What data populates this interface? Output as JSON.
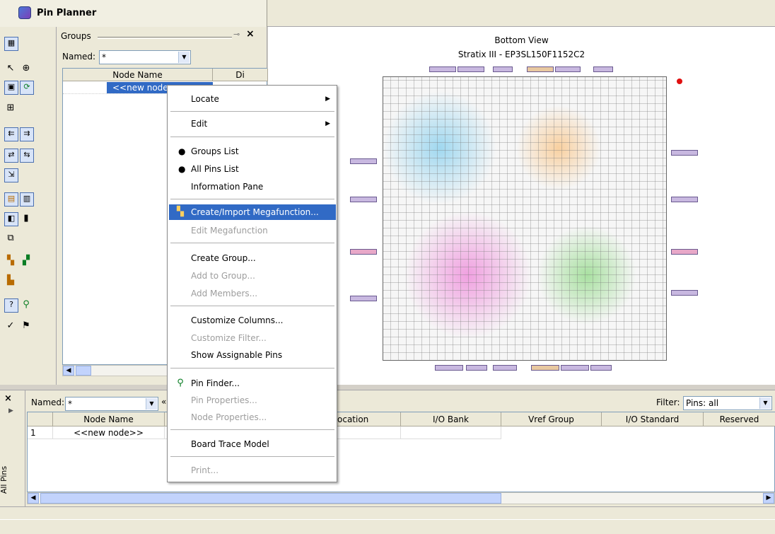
{
  "title": "Pin Planner",
  "groups_panel": {
    "title": "Groups",
    "named_label": "Named:",
    "named_value": "*",
    "columns": [
      "Node Name",
      "Di"
    ],
    "row": "<<new node>>"
  },
  "chip_view": {
    "title": "Bottom View",
    "subtitle": "Stratix III - EP3SL150F1152C2"
  },
  "bottom_panel": {
    "tab_label": "All Pins",
    "named_label": "Named:",
    "named_value": "*",
    "collapse_glyph": "«",
    "filter_label": "Filter:",
    "filter_value": "Pins: all",
    "columns": [
      "Node Name",
      "ocation",
      "I/O Bank",
      "Vref Group",
      "I/O Standard",
      "Reserved"
    ],
    "row": {
      "index": "1",
      "node": "<<new node>>"
    }
  },
  "context_menu": {
    "items": [
      {
        "label": "Locate",
        "submenu": true
      },
      {
        "label": "Edit",
        "submenu": true
      },
      {
        "label": "Groups List",
        "checked": true
      },
      {
        "label": "All Pins List",
        "checked": true
      },
      {
        "label": "Information Pane"
      },
      {
        "label": "Create/Import Megafunction...",
        "highlighted": true,
        "icon": "megafunction-icon"
      },
      {
        "label": "Edit Megafunction",
        "disabled": true
      },
      {
        "label": "Create Group..."
      },
      {
        "label": "Add to Group...",
        "disabled": true
      },
      {
        "label": "Add Members...",
        "disabled": true
      },
      {
        "label": "Customize Columns..."
      },
      {
        "label": "Customize Filter...",
        "disabled": true
      },
      {
        "label": "Show Assignable Pins"
      },
      {
        "label": "Pin Finder...",
        "icon": "binoculars-icon"
      },
      {
        "label": "Pin Properties...",
        "disabled": true
      },
      {
        "label": "Node Properties...",
        "disabled": true
      },
      {
        "label": "Board Trace Model"
      },
      {
        "label": "Print...",
        "disabled": true
      }
    ]
  },
  "colors": {
    "highlight": "#316ac5",
    "panel": "#ece9d8",
    "accent_pin": "#e01010"
  }
}
